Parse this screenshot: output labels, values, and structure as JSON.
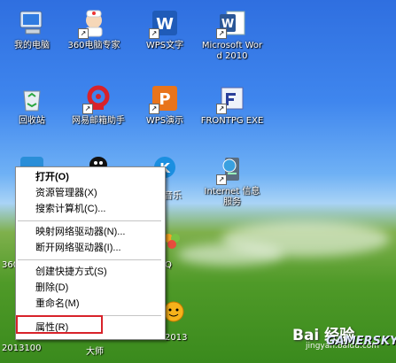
{
  "desktop_icons": [
    {
      "label": "我的电脑"
    },
    {
      "label": "360电脑专家"
    },
    {
      "label": "WPS文字"
    },
    {
      "label": "Microsoft Word 2010"
    },
    {
      "label": "回收站"
    },
    {
      "label": "网易邮箱助手"
    },
    {
      "label": "WPS演示"
    },
    {
      "label": "FRONTPG EXE"
    },
    {
      "label": "Internet 信息服务"
    }
  ],
  "partial_labels": {
    "icon_k": "音乐",
    "icon_qq": "Q",
    "bottom_left": "2013100",
    "bottom_mid": "大师",
    "bottom_right": "2013",
    "left_360": "360"
  },
  "context_menu": {
    "items": [
      {
        "label": "打开(O)",
        "bold": true
      },
      {
        "label": "资源管理器(X)"
      },
      {
        "label": "搜索计算机(C)..."
      },
      {
        "label": "映射网络驱动器(N)..."
      },
      {
        "label": "断开网络驱动器(I)..."
      },
      {
        "label": "创建快捷方式(S)"
      },
      {
        "label": "删除(D)"
      },
      {
        "label": "重命名(M)"
      },
      {
        "label": "属性(R)"
      }
    ]
  },
  "watermarks": {
    "baidu": "Bai 经验",
    "baidu_sub": "jingyan.baidu.com",
    "gamersky": "GAMERSKY"
  },
  "colors": {
    "highlight_box": "#d8222a",
    "sky": "#3f86ee",
    "grass": "#4f9a28"
  }
}
